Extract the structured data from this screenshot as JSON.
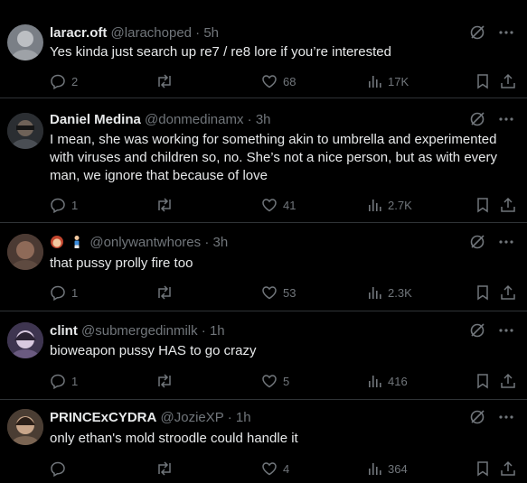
{
  "tweets": [
    {
      "name": "laracr.oft",
      "handle": "@larachoped",
      "time": "5h",
      "text": "Yes kinda just search up re7 / re8 lore if you’re interested",
      "replies": "2",
      "reposts": "",
      "likes": "68",
      "views": "17K",
      "avatar_color": "#7a7f86"
    },
    {
      "name": "Daniel Medina",
      "handle": "@donmedinamx",
      "time": "3h",
      "text": "I mean, she was working for something akin to umbrella and experimented with viruses and children so, no. She’s not a nice person, but as with every man, we ignore that because of love",
      "replies": "1",
      "reposts": "",
      "likes": "41",
      "views": "2.7K",
      "avatar_color": "#3b3f44"
    },
    {
      "name": "",
      "handle": "@onlywantwhores",
      "time": "3h",
      "text": "that pussy prolly fire too",
      "replies": "1",
      "reposts": "",
      "likes": "53",
      "views": "2.3K",
      "avatar_color": "#6b4a3e"
    },
    {
      "name": "clint",
      "handle": "@submergedinmilk",
      "time": "1h",
      "text": "bioweapon pussy HAS to go crazy",
      "replies": "1",
      "reposts": "",
      "likes": "5",
      "views": "416",
      "avatar_color": "#5a4b6e"
    },
    {
      "name": "PRINCExCYDRA",
      "handle": "@JozieXP",
      "time": "1h",
      "text": "only ethan's mold stroodle could handle it",
      "replies": "",
      "reposts": "",
      "likes": "4",
      "views": "364",
      "avatar_color": "#6e5a4a"
    }
  ],
  "dot": "·"
}
